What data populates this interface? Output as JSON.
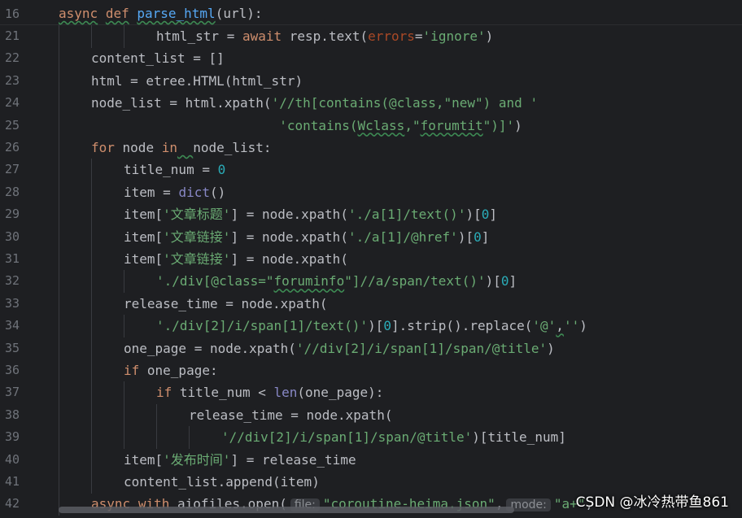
{
  "colors": {
    "background": "#1e1f22",
    "keyword": "#cf8e6d",
    "function": "#56a8f5",
    "string": "#6aab73",
    "number": "#2aacb8",
    "builtin": "#8888c6",
    "param": "#aa4926",
    "text": "#bcbec4",
    "line_number": "#6f737a"
  },
  "lines": [
    {
      "num": "16",
      "indent": 0,
      "sticky": true,
      "tokens": [
        {
          "t": "async",
          "c": "keyword",
          "u": true
        },
        {
          "t": " ",
          "c": "text"
        },
        {
          "t": "def",
          "c": "keyword",
          "u": true
        },
        {
          "t": " ",
          "c": "text"
        },
        {
          "t": "parse_html",
          "c": "function",
          "u": true
        },
        {
          "t": "(url):",
          "c": "text"
        }
      ]
    },
    {
      "num": "21",
      "indent": 3,
      "tokens": [
        {
          "t": "html_str = ",
          "c": "text"
        },
        {
          "t": "await",
          "c": "keyword"
        },
        {
          "t": " resp.text(",
          "c": "text"
        },
        {
          "t": "errors",
          "c": "param"
        },
        {
          "t": "=",
          "c": "text"
        },
        {
          "t": "'ignore'",
          "c": "string"
        },
        {
          "t": ")",
          "c": "text"
        }
      ]
    },
    {
      "num": "22",
      "indent": 1,
      "tokens": [
        {
          "t": "content_list = []",
          "c": "text"
        }
      ]
    },
    {
      "num": "23",
      "indent": 1,
      "tokens": [
        {
          "t": "html = etree.HTML(html_str)",
          "c": "text"
        }
      ]
    },
    {
      "num": "24",
      "indent": 1,
      "tokens": [
        {
          "t": "node_list = html.xpath(",
          "c": "text"
        },
        {
          "t": "'//th[contains(@class,\"new\") and '",
          "c": "string"
        }
      ]
    },
    {
      "num": "25",
      "indent": 1,
      "tokens": [
        {
          "t": "                        ",
          "c": "text"
        },
        {
          "t": "'contains(",
          "c": "string"
        },
        {
          "t": "Wclass",
          "c": "string",
          "u": true
        },
        {
          "t": ",\"",
          "c": "string"
        },
        {
          "t": "forumtit",
          "c": "string",
          "u": true
        },
        {
          "t": "\")]'",
          "c": "string"
        },
        {
          "t": ")",
          "c": "text"
        }
      ]
    },
    {
      "num": "26",
      "indent": 1,
      "tokens": [
        {
          "t": "for",
          "c": "keyword"
        },
        {
          "t": " node ",
          "c": "text"
        },
        {
          "t": "in",
          "c": "keyword"
        },
        {
          "t": "  ",
          "c": "text",
          "u": true
        },
        {
          "t": "node_list:",
          "c": "text"
        }
      ]
    },
    {
      "num": "27",
      "indent": 2,
      "tokens": [
        {
          "t": "title_num = ",
          "c": "text"
        },
        {
          "t": "0",
          "c": "number"
        }
      ]
    },
    {
      "num": "28",
      "indent": 2,
      "tokens": [
        {
          "t": "item = ",
          "c": "text"
        },
        {
          "t": "dict",
          "c": "builtin"
        },
        {
          "t": "()",
          "c": "text"
        }
      ]
    },
    {
      "num": "29",
      "indent": 2,
      "tokens": [
        {
          "t": "item[",
          "c": "text"
        },
        {
          "t": "'文章标题'",
          "c": "string"
        },
        {
          "t": "] = node.xpath(",
          "c": "text"
        },
        {
          "t": "'./a[1]/text()'",
          "c": "string"
        },
        {
          "t": ")[",
          "c": "text"
        },
        {
          "t": "0",
          "c": "number"
        },
        {
          "t": "]",
          "c": "text"
        }
      ]
    },
    {
      "num": "30",
      "indent": 2,
      "tokens": [
        {
          "t": "item[",
          "c": "text"
        },
        {
          "t": "'文章链接'",
          "c": "string"
        },
        {
          "t": "] = node.xpath(",
          "c": "text"
        },
        {
          "t": "'./a[1]/@href'",
          "c": "string"
        },
        {
          "t": ")[",
          "c": "text"
        },
        {
          "t": "0",
          "c": "number"
        },
        {
          "t": "]",
          "c": "text"
        }
      ]
    },
    {
      "num": "31",
      "indent": 2,
      "tokens": [
        {
          "t": "item[",
          "c": "text"
        },
        {
          "t": "'文章链接'",
          "c": "string"
        },
        {
          "t": "] = node.xpath(",
          "c": "text"
        }
      ]
    },
    {
      "num": "32",
      "indent": 3,
      "tokens": [
        {
          "t": "'./div[@class=\"",
          "c": "string"
        },
        {
          "t": "foruminfo",
          "c": "string",
          "u": true
        },
        {
          "t": "\"]//a/span/text()'",
          "c": "string"
        },
        {
          "t": ")[",
          "c": "text"
        },
        {
          "t": "0",
          "c": "number"
        },
        {
          "t": "]",
          "c": "text"
        }
      ]
    },
    {
      "num": "33",
      "indent": 2,
      "tokens": [
        {
          "t": "release_time = node.xpath(",
          "c": "text"
        }
      ]
    },
    {
      "num": "34",
      "indent": 3,
      "tokens": [
        {
          "t": "'./div[2]/i/span[1]/text()'",
          "c": "string"
        },
        {
          "t": ")[",
          "c": "text"
        },
        {
          "t": "0",
          "c": "number"
        },
        {
          "t": "].strip().replace(",
          "c": "text"
        },
        {
          "t": "'@'",
          "c": "string"
        },
        {
          "t": ",",
          "c": "text",
          "u": true
        },
        {
          "t": "''",
          "c": "string"
        },
        {
          "t": ")",
          "c": "text"
        }
      ]
    },
    {
      "num": "35",
      "indent": 2,
      "tokens": [
        {
          "t": "one_page = node.xpath(",
          "c": "text"
        },
        {
          "t": "'//div[2]/i/span[1]/span/@title'",
          "c": "string"
        },
        {
          "t": ")",
          "c": "text"
        }
      ]
    },
    {
      "num": "36",
      "indent": 2,
      "tokens": [
        {
          "t": "if",
          "c": "keyword"
        },
        {
          "t": " one_page:",
          "c": "text"
        }
      ]
    },
    {
      "num": "37",
      "indent": 3,
      "tokens": [
        {
          "t": "if",
          "c": "keyword"
        },
        {
          "t": " title_num < ",
          "c": "text"
        },
        {
          "t": "len",
          "c": "builtin"
        },
        {
          "t": "(one_page):",
          "c": "text"
        }
      ]
    },
    {
      "num": "38",
      "indent": 4,
      "tokens": [
        {
          "t": "release_time = node.xpath(",
          "c": "text"
        }
      ]
    },
    {
      "num": "39",
      "indent": 5,
      "tokens": [
        {
          "t": "'//div[2]/i/span[1]/span/@title'",
          "c": "string"
        },
        {
          "t": ")[title_num]",
          "c": "text"
        }
      ]
    },
    {
      "num": "40",
      "indent": 2,
      "tokens": [
        {
          "t": "item[",
          "c": "text"
        },
        {
          "t": "'发布时间'",
          "c": "string"
        },
        {
          "t": "] = release_time",
          "c": "text"
        }
      ]
    },
    {
      "num": "41",
      "indent": 2,
      "tokens": [
        {
          "t": "content_list.append(item)",
          "c": "text"
        }
      ]
    },
    {
      "num": "42",
      "indent": 1,
      "tokens": [
        {
          "t": "async",
          "c": "keyword"
        },
        {
          "t": " ",
          "c": "text"
        },
        {
          "t": "with",
          "c": "keyword"
        },
        {
          "t": " aiofiles.open(",
          "c": "text"
        },
        {
          "t": "file:",
          "c": "hint"
        },
        {
          "t": "\"coroutine-heima.json\"",
          "c": "string"
        },
        {
          "t": ",",
          "c": "text"
        },
        {
          "t": "mode:",
          "c": "hint"
        },
        {
          "t": "\"a+\"",
          "c": "string"
        },
        {
          "t": ",",
          "c": "text"
        }
      ]
    }
  ],
  "watermark": "CSDN @冰冷热带鱼861"
}
